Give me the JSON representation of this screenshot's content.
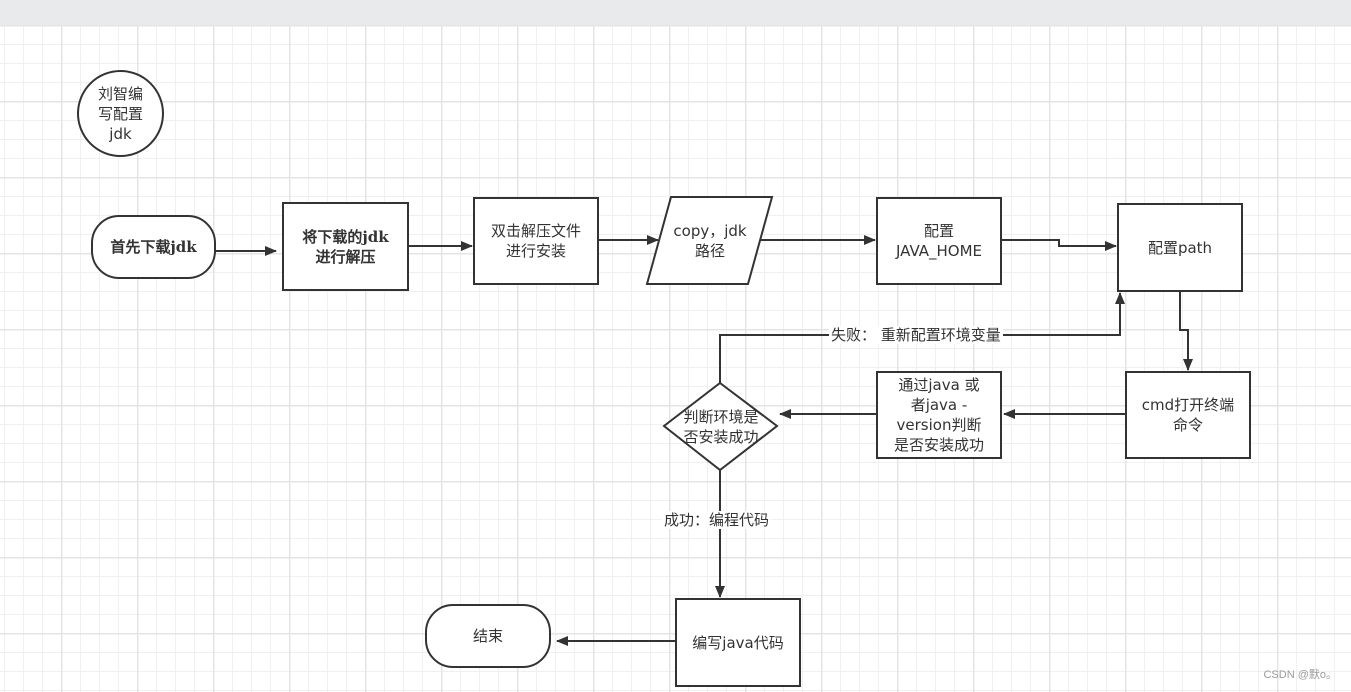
{
  "diagram": {
    "author_note": "刘智编\n写配置\njdk",
    "nodes": {
      "start": "首先下载jdk",
      "unzip": "将下载的jdk\n进行解压",
      "install": "双击解压文件\n进行安装",
      "copy_path": "copy，jdk\n路径",
      "java_home": "配置\nJAVA_HOME",
      "path": "配置path",
      "cmd": "cmd打开终端\n命令",
      "verify": "通过java 或\n者java -\nversion判断\n是否安装成功",
      "decision": "判断环境是\n否安装成功",
      "write_code": "编写java代码",
      "end": "结束"
    },
    "edges": {
      "fail_label": "失败：  重新配置环境变量",
      "success_label": "成功：编程代码"
    },
    "colors": {
      "stroke": "#333333",
      "grid": "#f0f0f0",
      "topbar": "#e9eaec"
    }
  },
  "watermark": "CSDN @默o。"
}
